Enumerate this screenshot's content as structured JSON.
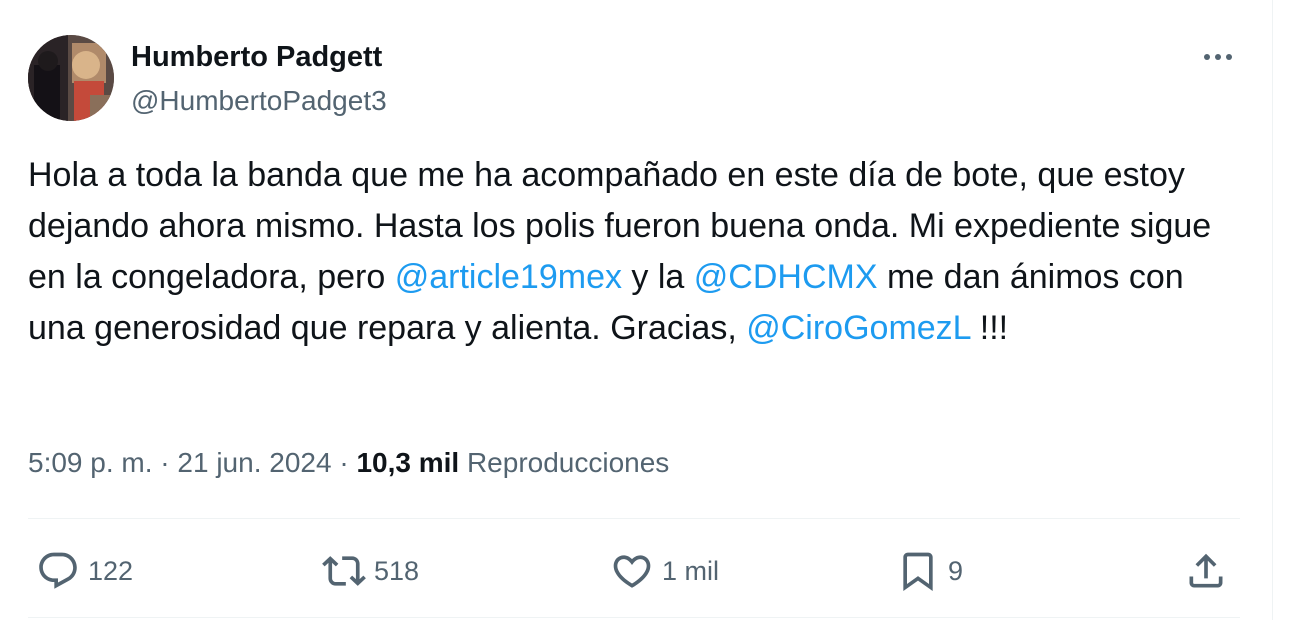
{
  "author": {
    "name": "Humberto Padgett",
    "handle": "@HumbertoPadget3"
  },
  "tweet": {
    "segments": [
      {
        "type": "text",
        "text": "Hola a toda la banda que me ha acompañado en este día de bote, que estoy dejando ahora mismo. Hasta los polis fueron buena onda. Mi expediente sigue en la congeladora, pero "
      },
      {
        "type": "mention",
        "text": "@article19mex"
      },
      {
        "type": "text",
        "text": " y la "
      },
      {
        "type": "mention",
        "text": "@CDHCMX"
      },
      {
        "type": "text",
        "text": " me dan ánimos con una generosidad que repara y alienta. Gracias, "
      },
      {
        "type": "mention",
        "text": "@CiroGomezL"
      },
      {
        "type": "text",
        "text": " !!!"
      }
    ]
  },
  "meta": {
    "time": "5:09 p. m.",
    "separator": "·",
    "date": "21 jun. 2024",
    "views_count": "10,3 mil",
    "views_label": "Reproducciones"
  },
  "actions": {
    "replies": "122",
    "reposts": "518",
    "likes": "1 mil",
    "bookmarks": "9"
  },
  "icons": {
    "more": "more-horizontal-icon",
    "reply": "reply-icon",
    "repost": "repost-icon",
    "like": "heart-icon",
    "bookmark": "bookmark-icon",
    "share": "share-icon"
  },
  "colors": {
    "text": "#0f1419",
    "secondary": "#536471",
    "link": "#1d9bf0",
    "border": "#eff3f4"
  }
}
